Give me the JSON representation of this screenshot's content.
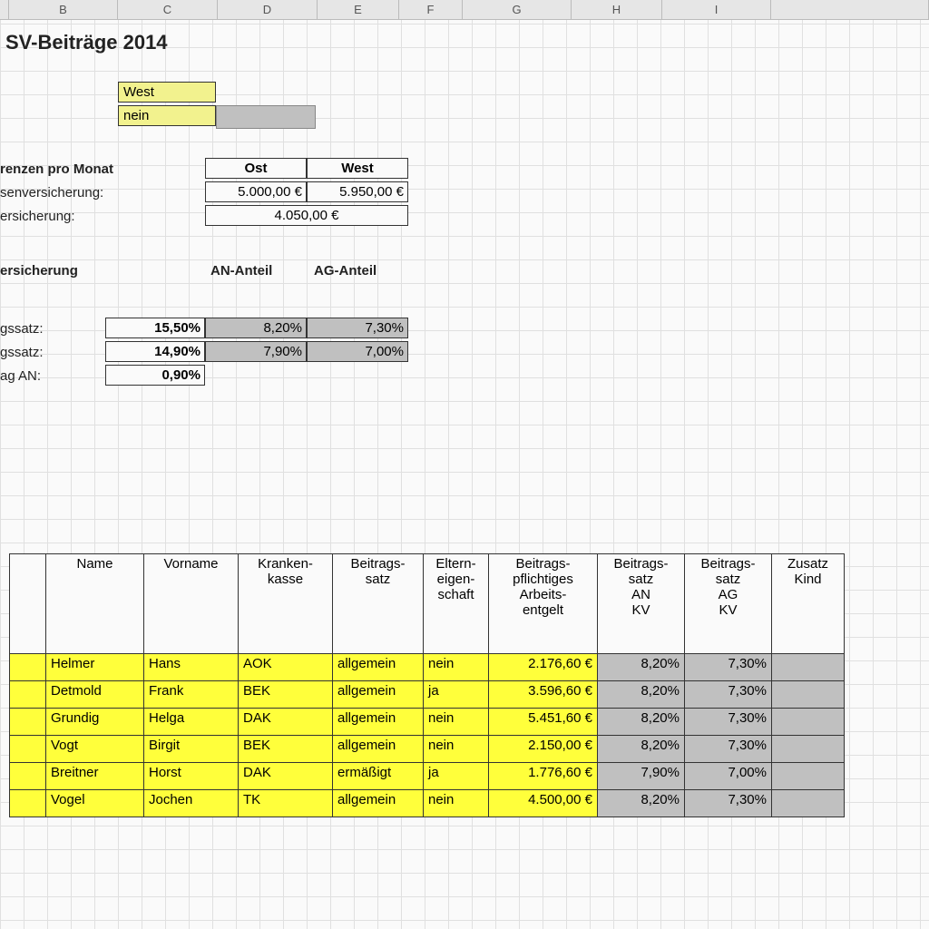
{
  "columns": [
    "B",
    "C",
    "D",
    "E",
    "F",
    "G",
    "H",
    "I"
  ],
  "title": "SV-Beiträge 2014",
  "dropdown": {
    "region": "West",
    "option2": "nein"
  },
  "limits": {
    "header": "renzen pro Monat",
    "col_ost": "Ost",
    "col_west": "West",
    "row1_label": "senversicherung:",
    "row1_ost": "5.000,00 €",
    "row1_west": "5.950,00 €",
    "row2_label": "ersicherung:",
    "row2_merged": "4.050,00 €"
  },
  "rates": {
    "section": "ersicherung",
    "an_header": "AN-Anteil",
    "ag_header": "AG-Anteil",
    "row1_label": "gssatz:",
    "row1_total": "15,50%",
    "row1_an": "8,20%",
    "row1_ag": "7,30%",
    "row2_label": "gssatz:",
    "row2_total": "14,90%",
    "row2_an": "7,90%",
    "row2_ag": "7,00%",
    "row3_label": "ag AN:",
    "row3_total": "0,90%"
  },
  "table": {
    "headers": [
      "Name",
      "Vorname",
      "Kranken-\nkasse",
      "Beitrags-\nsatz",
      "Eltern-\neigen-\nschaft",
      "Beitrags-\npflichtiges\nArbeits-\nentgelt",
      "Beitrags-\nsatz\nAN\nKV",
      "Beitrags-\nsatz\nAG\nKV",
      "Zusatz\nKind"
    ],
    "rows": [
      {
        "name": "Helmer",
        "vorname": "Hans",
        "kk": "AOK",
        "bs": "allgemein",
        "ee": "nein",
        "ae": "2.176,60 €",
        "an": "8,20%",
        "ag": "7,30%"
      },
      {
        "name": "Detmold",
        "vorname": "Frank",
        "kk": "BEK",
        "bs": "allgemein",
        "ee": "ja",
        "ae": "3.596,60 €",
        "an": "8,20%",
        "ag": "7,30%"
      },
      {
        "name": "Grundig",
        "vorname": "Helga",
        "kk": "DAK",
        "bs": "allgemein",
        "ee": "nein",
        "ae": "5.451,60 €",
        "an": "8,20%",
        "ag": "7,30%"
      },
      {
        "name": "Vogt",
        "vorname": "Birgit",
        "kk": "BEK",
        "bs": "allgemein",
        "ee": "nein",
        "ae": "2.150,00 €",
        "an": "8,20%",
        "ag": "7,30%"
      },
      {
        "name": "Breitner",
        "vorname": "Horst",
        "kk": "DAK",
        "bs": "ermäßigt",
        "ee": "ja",
        "ae": "1.776,60 €",
        "an": "7,90%",
        "ag": "7,00%"
      },
      {
        "name": "Vogel",
        "vorname": "Jochen",
        "kk": "TK",
        "bs": "allgemein",
        "ee": "nein",
        "ae": "4.500,00 €",
        "an": "8,20%",
        "ag": "7,30%"
      }
    ]
  }
}
